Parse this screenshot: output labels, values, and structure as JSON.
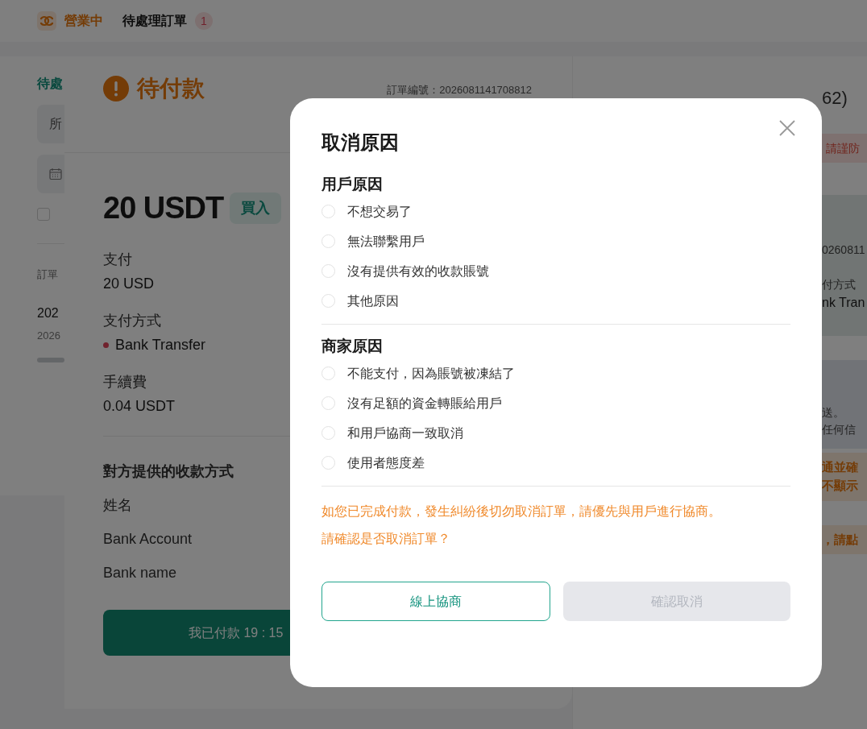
{
  "top_bar": {
    "status": "營業中",
    "pending_label": "待處理訂單",
    "pending_count": "1"
  },
  "left_panel": {
    "heading": "待處",
    "filter": "所",
    "checkbox": {
      "checked": false
    },
    "column_label": "訂單",
    "row_primary": "202",
    "row_secondary": "2026"
  },
  "order": {
    "status": "待付款",
    "order_number": "訂單編號：2026081141708812",
    "amount": "20 USDT",
    "side": "買入",
    "details": [
      {
        "label": "支付",
        "value": "20 USD",
        "kind": "plain"
      },
      {
        "label": "支付方式",
        "value": "Bank Transfer",
        "kind": "method"
      },
      {
        "label": "手續費",
        "value": "0.04 USDT",
        "kind": "plain"
      }
    ],
    "payee": {
      "title": "對方提供的收款方式",
      "fields": [
        "姓名",
        "Bank Account",
        "Bank name"
      ]
    },
    "paid_button": "我已付款 19 : 15"
  },
  "right_panel": {
    "counterpart": "62)",
    "warning": "請謹防",
    "order_number": "0260811",
    "method_label": "付方式",
    "method_value": "nk Tran",
    "notice_lines": [
      "送。",
      "任何信"
    ],
    "tips": [
      "通並確",
      "不顯示"
    ],
    "action_tip": "，請點"
  },
  "modal": {
    "title": "取消原因",
    "groups": [
      {
        "title": "用戶原因",
        "options": [
          {
            "label": "不想交易了",
            "selected": false
          },
          {
            "label": "無法聯繫用戶",
            "selected": false
          },
          {
            "label": "沒有提供有效的收款賬號",
            "selected": false
          },
          {
            "label": "其他原因",
            "selected": false
          }
        ]
      },
      {
        "title": "商家原因",
        "options": [
          {
            "label": "不能支付，因為賬號被凍結了",
            "selected": false
          },
          {
            "label": "沒有足額的資金轉賬給用戶",
            "selected": false
          },
          {
            "label": "和用戶協商一致取消",
            "selected": false
          },
          {
            "label": "使用者態度差",
            "selected": false
          }
        ]
      }
    ],
    "warnings": [
      "如您已完成付款，發生糾紛後切勿取消訂單，請優先與用戶進行協商。",
      "請確認是否取消訂單？"
    ],
    "buttons": [
      {
        "label": "線上協商",
        "kind": "outline",
        "disabled": false
      },
      {
        "label": "確認取消",
        "kind": "primary",
        "disabled": true
      }
    ]
  }
}
